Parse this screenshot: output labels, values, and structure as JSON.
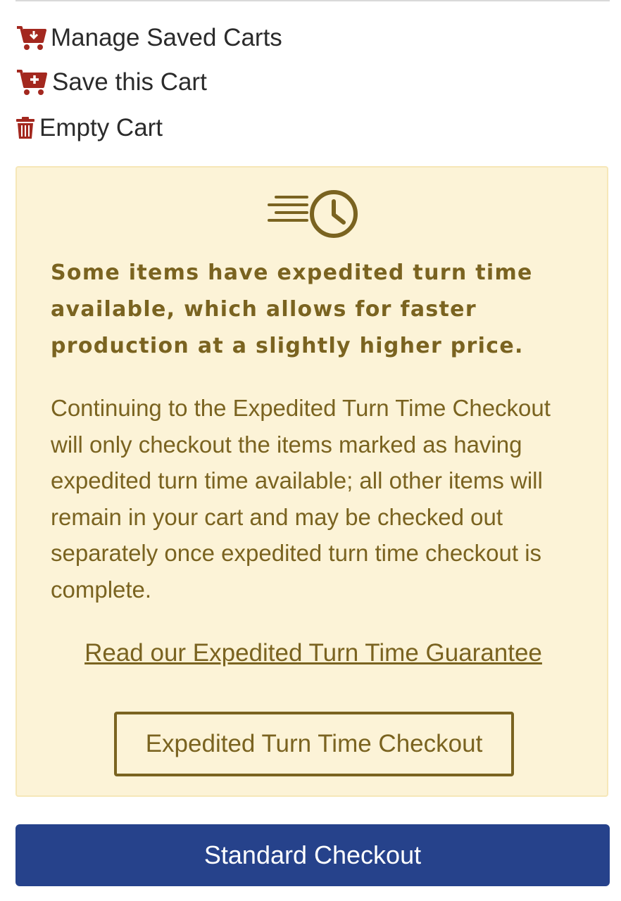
{
  "cart_actions": {
    "manage_label": "Manage Saved Carts",
    "save_label": "Save this Cart",
    "empty_label": "Empty Cart",
    "manage_icon": "cart-download-icon",
    "save_icon": "cart-plus-icon",
    "empty_icon": "trash-icon",
    "icon_color": "#a3281f"
  },
  "expedite": {
    "icon": "fast-clock-icon",
    "heading": "Some items have expedited turn time available, which allows for faster production at a slightly higher price.",
    "body": "Continuing to the Expedited Turn Time Checkout will only checkout the items marked as having expedited turn time available; all other items will remain in your cart and may be checked out separately once expedited turn time checkout is complete.",
    "guarantee_link": "Read our Expedited Turn Time Guarantee",
    "checkout_button": "Expedited Turn Time Checkout",
    "background_color": "#fcf3d7",
    "text_color": "#7a6320"
  },
  "standard_checkout": {
    "label": "Standard Checkout",
    "color": "#26428b"
  }
}
